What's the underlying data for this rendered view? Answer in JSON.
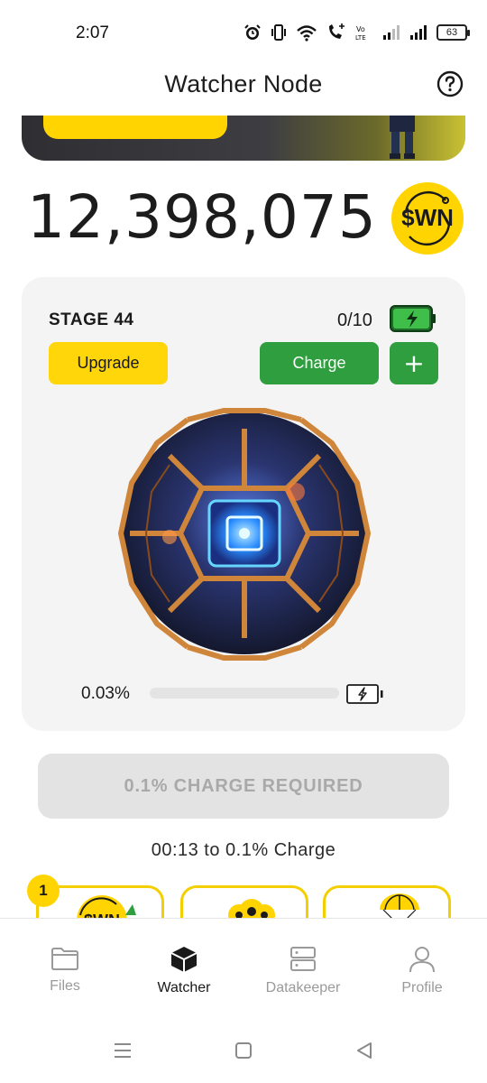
{
  "status_bar": {
    "time": "2:07",
    "battery_level": "63",
    "icons": [
      "alarm-icon",
      "vibrate-icon",
      "wifi-icon",
      "call-icon",
      "volte-icon",
      "signal-icon",
      "signal-icon",
      "battery-icon"
    ]
  },
  "header": {
    "title": "Watcher Node",
    "help_icon": "help-icon"
  },
  "balance": {
    "amount": "12,398,075",
    "token_label": "$WN"
  },
  "node": {
    "stage_label": "STAGE 44",
    "charges": "0/10",
    "upgrade_label": "Upgrade",
    "charge_label": "Charge",
    "plus_label": "+",
    "progress_text": "0.03%",
    "progress_value": 0.0003
  },
  "charge_required_label": "0.1% CHARGE REQUIRED",
  "countdown_text": "00:13 to 0.1% Charge",
  "tiles": {
    "badge": "1",
    "token_label": "$WN"
  },
  "bottom_nav": {
    "items": [
      {
        "label": "Files",
        "icon": "folder-icon"
      },
      {
        "label": "Watcher",
        "icon": "cube-icon"
      },
      {
        "label": "Datakeeper",
        "icon": "server-icon"
      },
      {
        "label": "Profile",
        "icon": "user-icon"
      }
    ],
    "active": "Watcher"
  },
  "colors": {
    "accent_yellow": "#ffd400",
    "accent_green": "#2e9e3e",
    "card_bg": "#f4f4f4"
  }
}
